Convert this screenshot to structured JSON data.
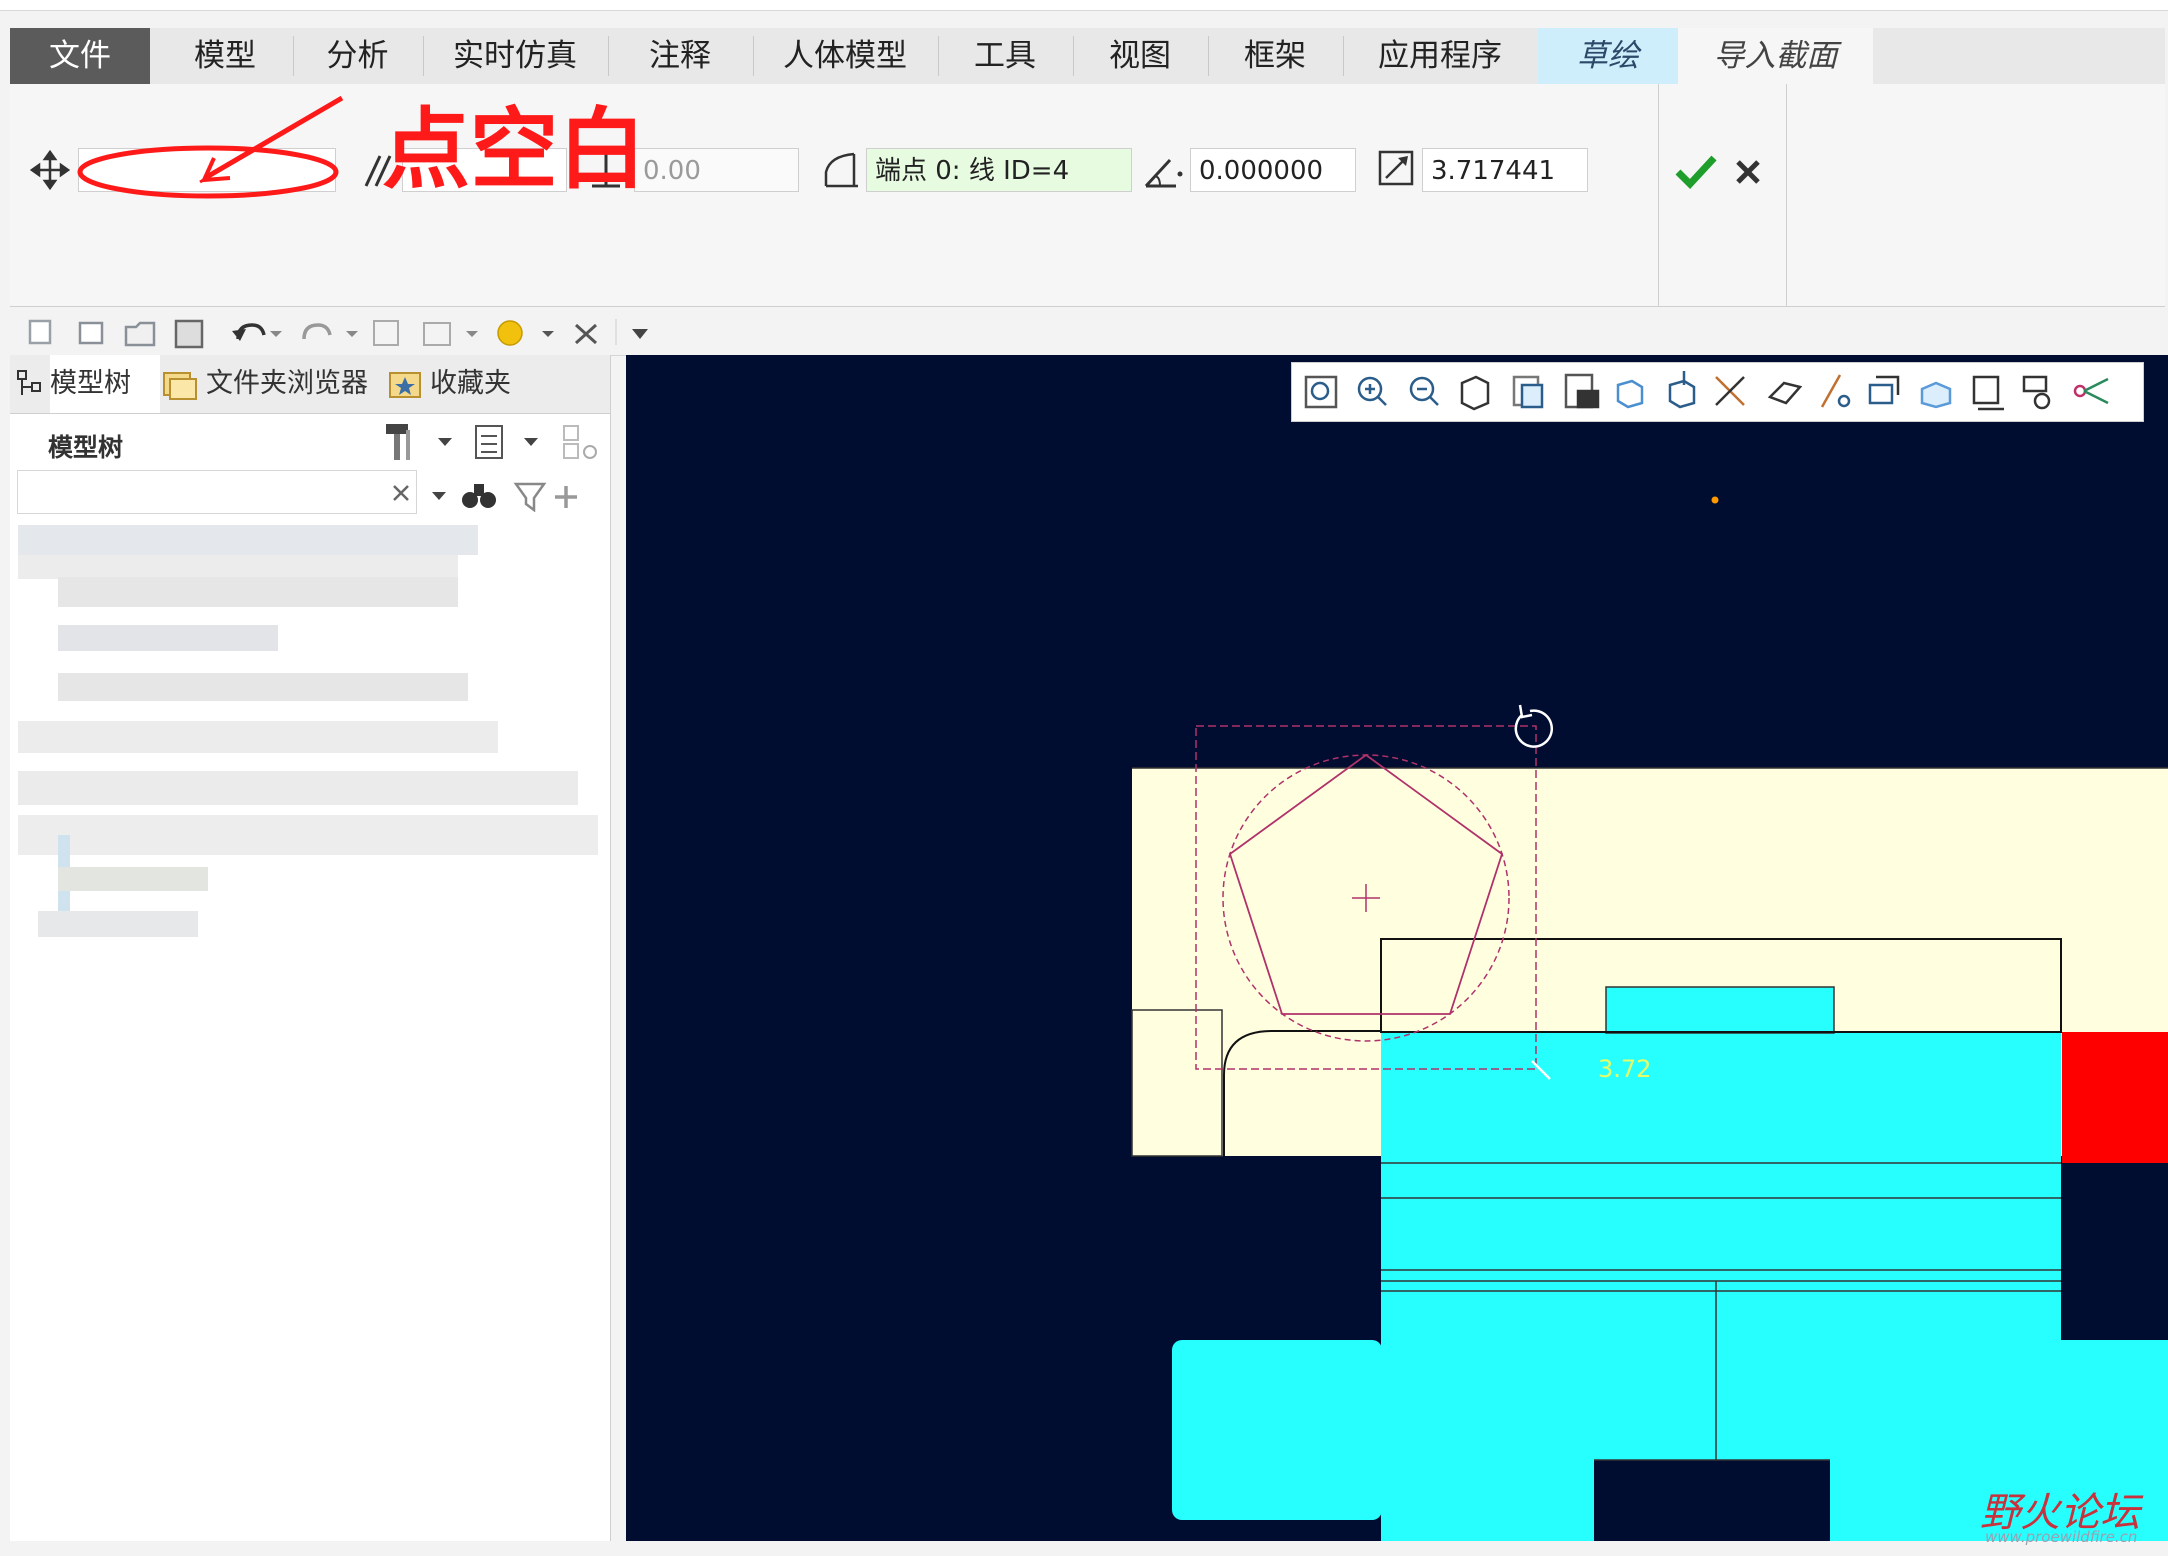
{
  "ribbon": {
    "tabs": [
      {
        "label": "文件"
      },
      {
        "label": "模型"
      },
      {
        "label": "分析"
      },
      {
        "label": "实时仿真"
      },
      {
        "label": "注释"
      },
      {
        "label": "人体模型"
      },
      {
        "label": "工具"
      },
      {
        "label": "视图"
      },
      {
        "label": "框架"
      },
      {
        "label": "应用程序"
      },
      {
        "label": "草绘"
      },
      {
        "label": "导入截面"
      }
    ]
  },
  "dashboard": {
    "disabled_value": "0.00",
    "reference_value": "端点 0: 线 ID=4",
    "angle_value": "0.000000",
    "scale_value": "3.717441"
  },
  "annotation": {
    "text": "点空白"
  },
  "navigator": {
    "tabs": [
      {
        "label": "模型树"
      },
      {
        "label": "文件夹浏览器"
      },
      {
        "label": "收藏夹"
      }
    ],
    "panel_title": "模型树",
    "search_placeholder": ""
  },
  "graphics": {
    "dimension_label": "3.72"
  },
  "watermark": {
    "text": "野火论坛",
    "url": "www.proewildfire.cn"
  },
  "colors": {
    "background": "#000d30",
    "cyan": "#27ffff",
    "yellow_section": "#ffffe0",
    "red": "#ff0000",
    "sketch": "#b0326a",
    "annotation": "#ff1a1a",
    "accept": "#1f9e2b"
  }
}
